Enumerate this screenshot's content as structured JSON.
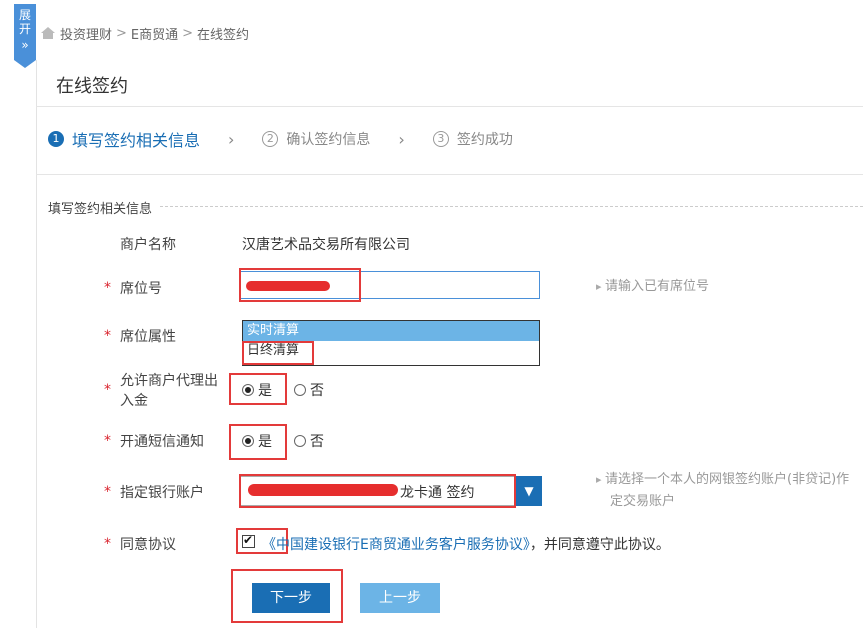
{
  "expand_tab": {
    "label_1": "展",
    "label_2": "开",
    "chevron": "»"
  },
  "breadcrumb": {
    "home_icon": "home-icon",
    "items": [
      "投资理财",
      "E商贸通",
      "在线签约"
    ],
    "separator": ">"
  },
  "page": {
    "title": "在线签约"
  },
  "steps": [
    {
      "num": "1",
      "label": "填写签约相关信息",
      "state": "active"
    },
    {
      "num": "2",
      "label": "确认签约信息",
      "state": "inactive"
    },
    {
      "num": "3",
      "label": "签约成功",
      "state": "inactive"
    }
  ],
  "section": {
    "title": "填写签约相关信息"
  },
  "form": {
    "required_mark": "*",
    "merchant": {
      "label": "商户名称",
      "value": "汉唐艺术品交易所有限公司"
    },
    "seat_no": {
      "label": "席位号",
      "hint": "请输入已有席位号"
    },
    "seat_attr": {
      "label": "席位属性",
      "options": [
        "实时清算",
        "日终清算"
      ],
      "selected": "实时清算"
    },
    "proxy_transfer": {
      "label_1": "允许商户代理出",
      "label_2": "入金",
      "yes": "是",
      "no": "否",
      "selected": "是"
    },
    "sms": {
      "label": "开通短信通知",
      "yes": "是",
      "no": "否",
      "selected": "是"
    },
    "bank_account": {
      "label": "指定银行账户",
      "value_suffix": "龙卡通 签约",
      "hint_1": "请选择一个本人的网银签约账户(非贷记)作",
      "hint_2": "定交易账户"
    },
    "agreement": {
      "label": "同意协议",
      "link": "《中国建设银行E商贸通业务客户服务协议》",
      "suffix": "，并同意遵守此协议。",
      "checked": true
    }
  },
  "buttons": {
    "next": "下一步",
    "prev": "上一步"
  },
  "colors": {
    "primary": "#1a6eb4",
    "secondary": "#6cb4e6",
    "required": "#d9232d",
    "annotation": "#e33a3a"
  }
}
